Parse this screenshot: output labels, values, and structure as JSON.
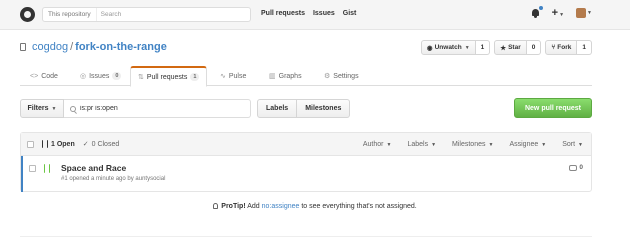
{
  "header": {
    "search_scope": "This repository",
    "search_placeholder": "Search",
    "nav": [
      "Pull requests",
      "Issues",
      "Gist"
    ]
  },
  "repo": {
    "owner": "cogdog",
    "separator": "/",
    "name": "fork-on-the-range",
    "actions": [
      {
        "label": "Unwatch",
        "count": "1"
      },
      {
        "label": "Star",
        "count": "0"
      },
      {
        "label": "Fork",
        "count": "1"
      }
    ]
  },
  "tabs": [
    {
      "label": "Code",
      "count": ""
    },
    {
      "label": "Issues",
      "count": "0"
    },
    {
      "label": "Pull requests",
      "count": "1"
    },
    {
      "label": "Pulse",
      "count": ""
    },
    {
      "label": "Graphs",
      "count": ""
    },
    {
      "label": "Settings",
      "count": ""
    }
  ],
  "filters": {
    "button_label": "Filters",
    "query": "is:pr is:open",
    "labels_label": "Labels",
    "milestones_label": "Milestones",
    "new_pr_label": "New pull request"
  },
  "list": {
    "open_label": "1 Open",
    "closed_label": "0 Closed",
    "sorters": [
      "Author",
      "Labels",
      "Milestones",
      "Assignee",
      "Sort"
    ],
    "items": [
      {
        "title": "Space and Race",
        "meta": "#1 opened a minute ago by auntysocial",
        "comments": "0"
      }
    ]
  },
  "protip": {
    "lead": "ProTip!",
    "text_before": "Add",
    "link": "no:assignee",
    "text_after": "to see everything that's not assigned."
  },
  "colors": {
    "accent": "#4183c4",
    "new_pr_button": "#6cc644",
    "selected_tab_border": "#d26911"
  }
}
